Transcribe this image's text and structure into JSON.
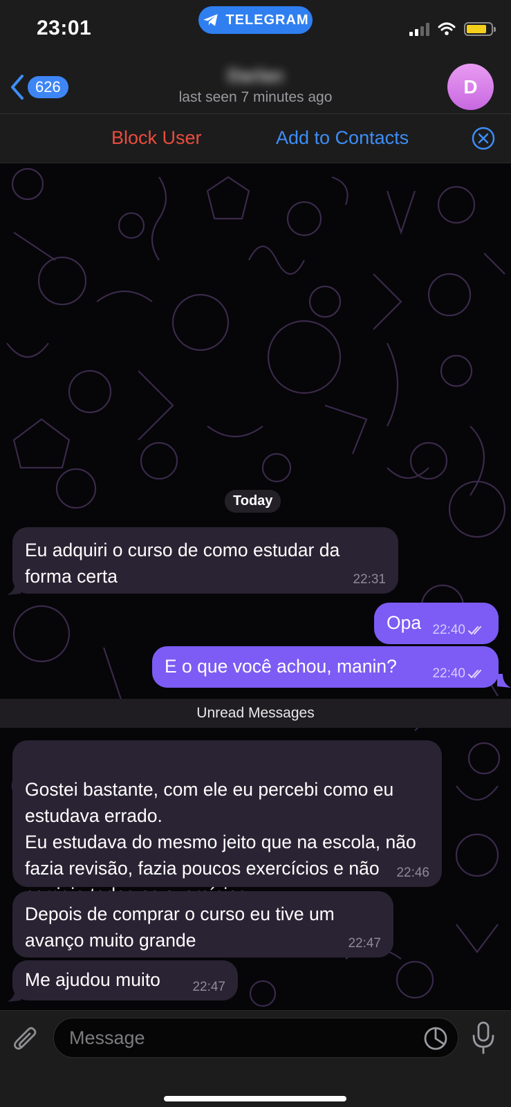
{
  "status_bar": {
    "time": "23:01",
    "app_pill": "TELEGRAM",
    "battery_level": 0.82
  },
  "header": {
    "back_count": "626",
    "contact_name": "Darlan",
    "last_seen": "last seen 7 minutes ago",
    "avatar_initial": "D"
  },
  "action_bar": {
    "block_label": "Block User",
    "add_label": "Add to Contacts"
  },
  "chat": {
    "date_chip": "Today",
    "unread_label": "Unread Messages",
    "messages": [
      {
        "direction": "in",
        "text": "Eu adquiri o curso de como estudar da forma certa",
        "time": "22:31"
      },
      {
        "direction": "out",
        "text": "Opa",
        "time": "22:40",
        "status": "read"
      },
      {
        "direction": "out",
        "text": "E o que você achou, manin?",
        "time": "22:40",
        "status": "read"
      },
      {
        "direction": "in",
        "text": "Gostei bastante, com ele eu percebi como eu estudava errado.\nEu estudava do mesmo jeito que na escola, não fazia revisão, fazia poucos exercícios e não corrigia todos os exercícios.",
        "time": "22:46"
      },
      {
        "direction": "in",
        "text": "Depois de comprar o curso eu tive um avanço muito grande",
        "time": "22:47"
      },
      {
        "direction": "in",
        "text": "Me ajudou muito",
        "time": "22:47"
      }
    ]
  },
  "input_bar": {
    "placeholder": "Message"
  },
  "colors": {
    "accent_blue": "#3e8ef6",
    "block_red": "#eb4d3d",
    "outgoing_bubble": "#7c5cf4",
    "incoming_bubble": "#2a2333"
  },
  "icons": [
    "telegram-icon",
    "signal-icon",
    "wifi-icon",
    "battery-icon",
    "back-chevron-icon",
    "close-circle-icon",
    "attach-icon",
    "sticker-icon",
    "microphone-icon",
    "double-check-icon"
  ]
}
